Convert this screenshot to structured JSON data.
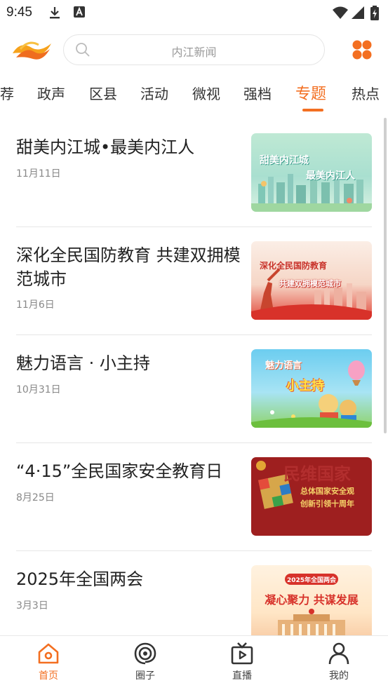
{
  "status_bar": {
    "time": "9:45"
  },
  "header": {
    "search_placeholder": "内江新闻"
  },
  "tabs": [
    {
      "label": "荐"
    },
    {
      "label": "政声"
    },
    {
      "label": "区县"
    },
    {
      "label": "活动"
    },
    {
      "label": "微视"
    },
    {
      "label": "强档"
    },
    {
      "label": "专题",
      "active": true
    },
    {
      "label": "热点"
    }
  ],
  "articles": [
    {
      "title": "甜美内江城•最美内江人",
      "date": "11月11日",
      "thumb_text_1": "甜美内江城",
      "thumb_text_2": "最美内江人"
    },
    {
      "title": "深化全民国防教育 共建双拥模范城市",
      "date": "11月6日",
      "thumb_text_1": "深化全民国防教育",
      "thumb_text_2": "共建双拥模范城市"
    },
    {
      "title": "魅力语言 · 小主持",
      "date": "10月31日",
      "thumb_text_1": "魅力语言",
      "thumb_text_2": "小主持"
    },
    {
      "title": "“4·15”全民国家安全教育日",
      "date": "8月25日",
      "thumb_text_1": "总体国家安全观",
      "thumb_text_2": "创新引领十周年",
      "thumb_text_3": "民维国家"
    },
    {
      "title": "2025年全国两会",
      "date": "3月3日",
      "thumb_text_1": "2025年全国两会",
      "thumb_text_2": "凝心聚力 共谋发展"
    }
  ],
  "bottom_nav": [
    {
      "label": "首页",
      "icon": "home-icon",
      "active": true
    },
    {
      "label": "圈子",
      "icon": "circle-icon"
    },
    {
      "label": "直播",
      "icon": "tv-icon"
    },
    {
      "label": "我的",
      "icon": "user-icon"
    }
  ],
  "colors": {
    "accent": "#f36f21",
    "text": "#222222",
    "muted": "#888888"
  }
}
